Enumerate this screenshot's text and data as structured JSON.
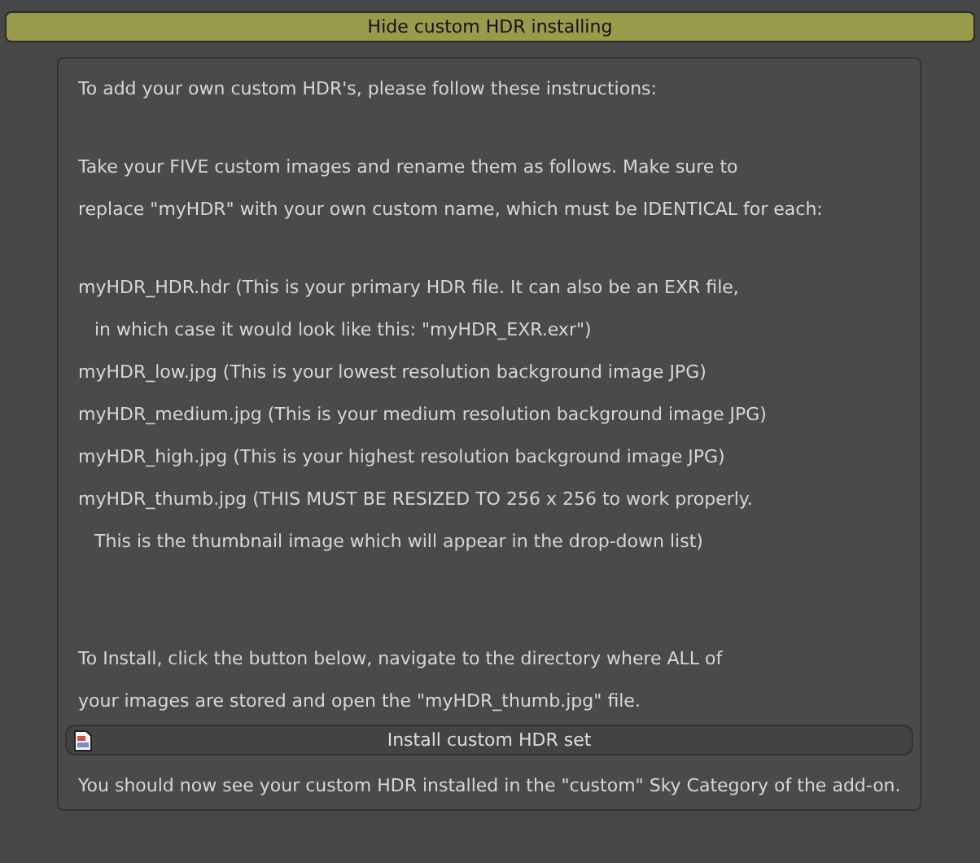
{
  "toggle_button": {
    "label": "Hide custom HDR installing",
    "selected": true
  },
  "panel": {
    "groups": [
      [
        {
          "text": "To add your own custom HDR's, please follow these instructions:",
          "indented": false
        }
      ],
      [
        {
          "text": "Take your FIVE custom images and rename them as follows. Make sure to",
          "indented": false
        },
        {
          "text": "replace \"myHDR\" with your own custom name, which must be IDENTICAL for each:",
          "indented": false
        }
      ],
      [
        {
          "text": "myHDR_HDR.hdr  (This is your primary HDR file. It can also be an EXR file,",
          "indented": false
        },
        {
          "text": "in which case it would look like this: \"myHDR_EXR.exr\")",
          "indented": true
        },
        {
          "text": "myHDR_low.jpg  (This is your lowest resolution background image JPG)",
          "indented": false
        },
        {
          "text": "myHDR_medium.jpg  (This is your medium resolution background image JPG)",
          "indented": false
        },
        {
          "text": "myHDR_high.jpg  (This is your highest resolution background image JPG)",
          "indented": false
        },
        {
          "text": "myHDR_thumb.jpg (THIS MUST BE RESIZED TO 256 x 256 to work properly.",
          "indented": false
        },
        {
          "text": "This is the thumbnail image which will appear in the drop-down list)",
          "indented": true
        }
      ],
      [
        {
          "text": "To Install, click the button below, navigate to the directory where ALL of",
          "indented": false
        },
        {
          "text": "your images are stored and open the \"myHDR_thumb.jpg\" file.",
          "indented": false
        }
      ]
    ],
    "install_button": {
      "label": "Install custom HDR set"
    },
    "footer": "You should now see your custom HDR installed in the \"custom\" Sky Category of the add-on."
  }
}
